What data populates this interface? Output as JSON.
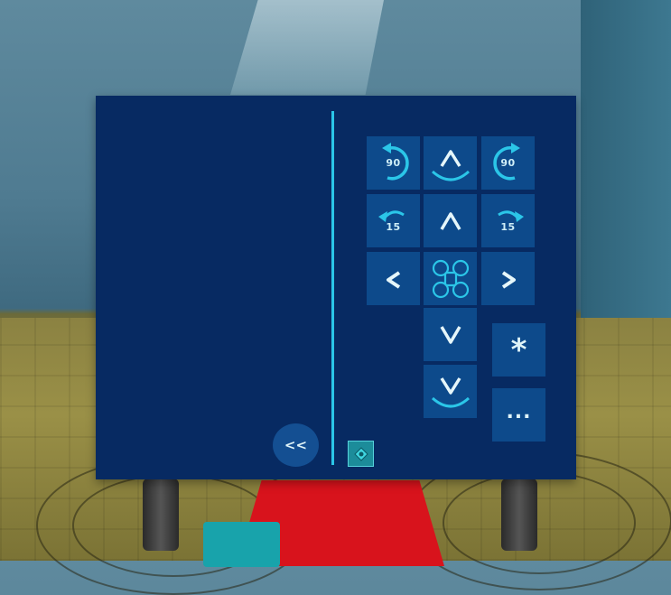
{
  "controls": {
    "rotate_left_90": {
      "label": "90",
      "icon": "rotate-left-icon"
    },
    "ascend": {
      "icon": "ascend-icon"
    },
    "rotate_right_90": {
      "label": "90",
      "icon": "rotate-right-icon"
    },
    "rotate_left_15": {
      "label": "15",
      "icon": "rotate-left-icon"
    },
    "forward": {
      "label": "^"
    },
    "rotate_right_15": {
      "label": "15",
      "icon": "rotate-right-icon"
    },
    "left": {
      "label": "<"
    },
    "center": {
      "icon": "drone-icon"
    },
    "right": {
      "label": ">"
    },
    "backward": {
      "label": "V"
    },
    "descend": {
      "icon": "descend-icon"
    },
    "star": {
      "label": "*"
    },
    "more": {
      "label": "..."
    },
    "collapse": {
      "label": "<<"
    },
    "status": {
      "icon": "drone-status-icon"
    }
  },
  "colors": {
    "panel": "#072a62",
    "button": "#0d4a8b",
    "accent": "#2bc6e8"
  }
}
